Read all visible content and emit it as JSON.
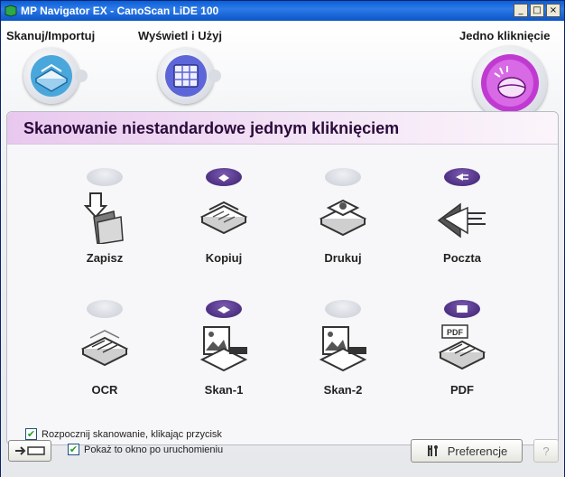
{
  "window": {
    "title": "MP Navigator EX - CanoScan LiDE 100",
    "minimize": "_",
    "maximize": "□",
    "close": "×"
  },
  "nav": {
    "scan_import": "Skanuj/Importuj",
    "view_use": "Wyświetl i Użyj",
    "one_click": "Jedno kliknięcie"
  },
  "panel": {
    "title": "Skanowanie niestandardowe jednym kliknięciem"
  },
  "tiles": [
    {
      "label": "Zapisz",
      "icon": "save-folder-icon",
      "badge": "none"
    },
    {
      "label": "Kopiuj",
      "icon": "copy-icon",
      "badge": "copy-badge-icon"
    },
    {
      "label": "Drukuj",
      "icon": "print-icon",
      "badge": "none"
    },
    {
      "label": "Poczta",
      "icon": "mail-icon",
      "badge": "mail-badge-icon"
    },
    {
      "label": "OCR",
      "icon": "ocr-icon",
      "badge": "none"
    },
    {
      "label": "Skan-1",
      "icon": "scan-image-icon",
      "badge": "scanner-badge-icon"
    },
    {
      "label": "Skan-2",
      "icon": "scan-image-icon",
      "badge": "none"
    },
    {
      "label": "PDF",
      "icon": "pdf-icon",
      "badge": "pdf-badge-icon"
    }
  ],
  "start_scan_checkbox": {
    "label": "Rozpocznij skanowanie, klikając przycisk",
    "checked": true
  },
  "footer": {
    "show_window_checkbox": {
      "label": "Pokaż to okno po uruchomieniu",
      "checked": true
    },
    "preferences_label": "Preferencje",
    "help_label": "?"
  },
  "colors": {
    "title_bar": "#0b55c8",
    "panel_header": "#e9c8ef",
    "accent_purple": "#7b2a8c"
  }
}
